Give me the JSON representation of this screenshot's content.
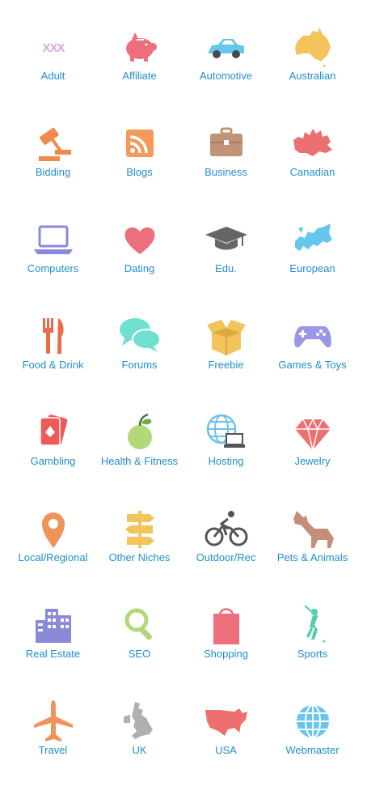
{
  "categories": [
    {
      "label": "Adult",
      "icon": "xxx-icon",
      "color": "#d8a8d8"
    },
    {
      "label": "Affiliate",
      "icon": "piggy-bank-icon",
      "color": "#ee6f7c"
    },
    {
      "label": "Automotive",
      "icon": "car-icon",
      "color": "#66c6ee"
    },
    {
      "label": "Australian",
      "icon": "australia-map-icon",
      "color": "#f4c45c"
    },
    {
      "label": "Bidding",
      "icon": "gavel-icon",
      "color": "#f08a4b"
    },
    {
      "label": "Blogs",
      "icon": "rss-icon",
      "color": "#f39a5a"
    },
    {
      "label": "Business",
      "icon": "briefcase-icon",
      "color": "#c19478"
    },
    {
      "label": "Canadian",
      "icon": "canada-map-icon",
      "color": "#ee6f6f"
    },
    {
      "label": "Computers",
      "icon": "laptop-icon",
      "color": "#8a8ad8"
    },
    {
      "label": "Dating",
      "icon": "heart-icon",
      "color": "#ee6f7c"
    },
    {
      "label": "Edu.",
      "icon": "graduation-cap-icon",
      "color": "#666666"
    },
    {
      "label": "European",
      "icon": "europe-map-icon",
      "color": "#66c6ee"
    },
    {
      "label": "Food & Drink",
      "icon": "fork-knife-icon",
      "color": "#f06a4a"
    },
    {
      "label": "Forums",
      "icon": "chat-bubbles-icon",
      "color": "#6fe0d0"
    },
    {
      "label": "Freebie",
      "icon": "open-box-icon",
      "color": "#f4c45c"
    },
    {
      "label": "Games & Toys",
      "icon": "gamepad-icon",
      "color": "#9a96e8"
    },
    {
      "label": "Gambling",
      "icon": "playing-cards-icon",
      "color": "#ee5a5a"
    },
    {
      "label": "Health & Fitness",
      "icon": "apple-icon",
      "color": "#b2d87a"
    },
    {
      "label": "Hosting",
      "icon": "globe-laptop-icon",
      "color": "#6ec2e6"
    },
    {
      "label": "Jewelry",
      "icon": "diamond-icon",
      "color": "#ee6f6f"
    },
    {
      "label": "Local/Regional",
      "icon": "map-pin-icon",
      "color": "#f0935a"
    },
    {
      "label": "Other Niches",
      "icon": "signpost-icon",
      "color": "#f4c45c"
    },
    {
      "label": "Outdoor/Rec",
      "icon": "cyclist-icon",
      "color": "#555555"
    },
    {
      "label": "Pets & Animals",
      "icon": "dog-icon",
      "color": "#c58e7a"
    },
    {
      "label": "Real Estate",
      "icon": "buildings-icon",
      "color": "#8a8ad8"
    },
    {
      "label": "SEO",
      "icon": "magnifier-icon",
      "color": "#b2d87a"
    },
    {
      "label": "Shopping",
      "icon": "shopping-bag-icon",
      "color": "#ee6f7c"
    },
    {
      "label": "Sports",
      "icon": "golfer-icon",
      "color": "#4fd0a8"
    },
    {
      "label": "Travel",
      "icon": "airplane-icon",
      "color": "#f0935a"
    },
    {
      "label": "UK",
      "icon": "uk-map-icon",
      "color": "#b0b0b0"
    },
    {
      "label": "USA",
      "icon": "usa-map-icon",
      "color": "#ee6f6f"
    },
    {
      "label": "Webmaster",
      "icon": "globe-icon",
      "color": "#66c6ee"
    }
  ]
}
